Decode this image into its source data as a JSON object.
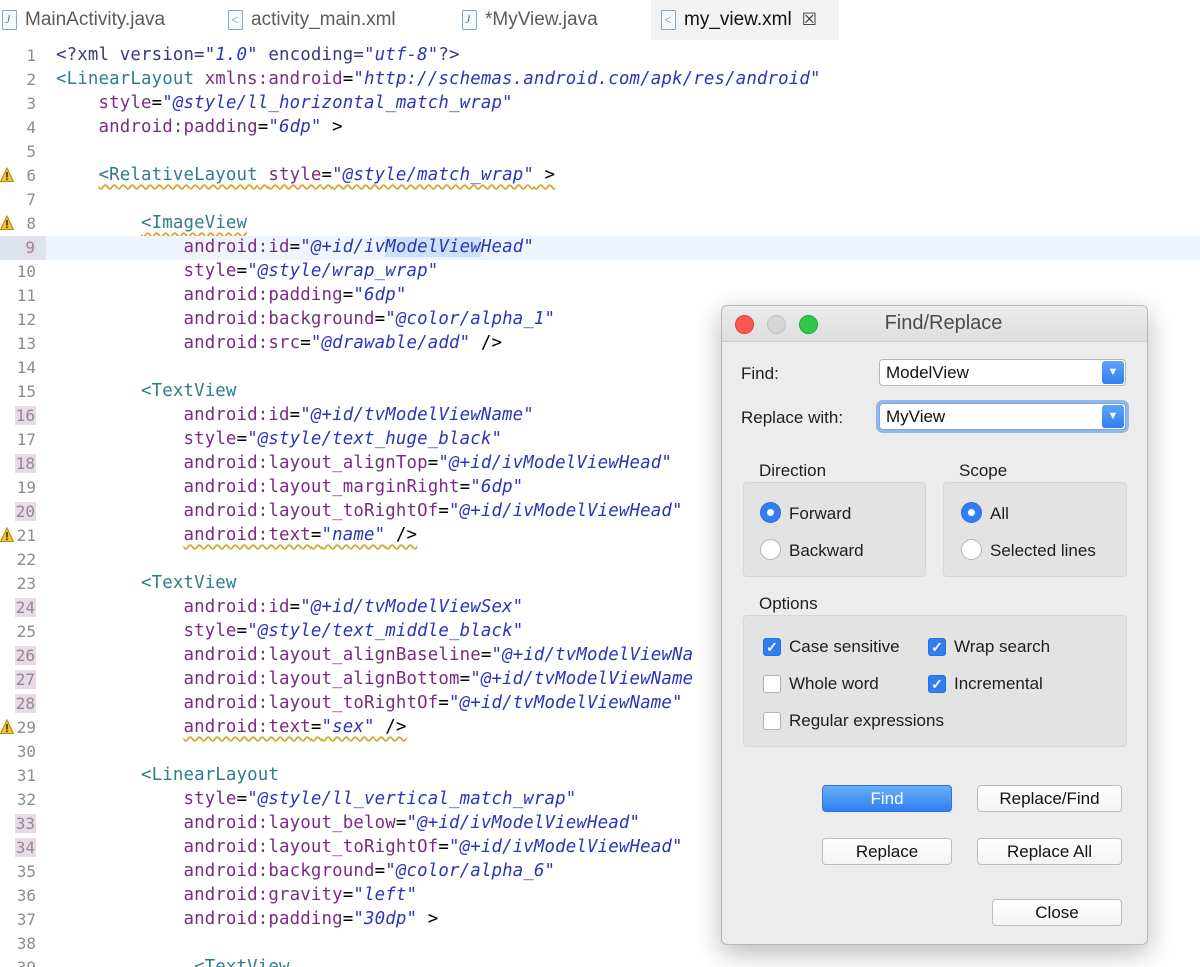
{
  "tabs": [
    {
      "label": "MainActivity.java",
      "icon": "java-file-icon",
      "active": false
    },
    {
      "label": "activity_main.xml",
      "icon": "xml-file-icon",
      "active": false
    },
    {
      "label": "*MyView.java",
      "icon": "java-file-icon",
      "active": false
    },
    {
      "label": "my_view.xml",
      "icon": "xml-file-icon",
      "active": true,
      "close": "☒"
    }
  ],
  "editor": {
    "current_line": 9,
    "lines": [
      {
        "n": "1",
        "text": "<?xml version=\"1.0\" encoding=\"utf-8\"?>"
      },
      {
        "n": "2",
        "text": "<LinearLayout xmlns:android=\"http://schemas.android.com/apk/res/android\""
      },
      {
        "n": "3",
        "text": "    style=\"@style/ll_horizontal_match_wrap\""
      },
      {
        "n": "4",
        "text": "    android:padding=\"6dp\" >"
      },
      {
        "n": "5",
        "text": ""
      },
      {
        "n": "6",
        "text": "    <RelativeLayout style=\"@style/match_wrap\" >",
        "warn": true
      },
      {
        "n": "7",
        "text": ""
      },
      {
        "n": "8",
        "text": "        <ImageView",
        "warn": true
      },
      {
        "n": "9",
        "text": "            android:id=\"@+id/ivModelViewHead\"",
        "marked": true
      },
      {
        "n": "10",
        "text": "            style=\"@style/wrap_wrap\""
      },
      {
        "n": "11",
        "text": "            android:padding=\"6dp\""
      },
      {
        "n": "12",
        "text": "            android:background=\"@color/alpha_1\""
      },
      {
        "n": "13",
        "text": "            android:src=\"@drawable/add\" />"
      },
      {
        "n": "14",
        "text": ""
      },
      {
        "n": "15",
        "text": "        <TextView"
      },
      {
        "n": "16",
        "text": "            android:id=\"@+id/tvModelViewName\"",
        "marked": true
      },
      {
        "n": "17",
        "text": "            style=\"@style/text_huge_black\""
      },
      {
        "n": "18",
        "text": "            android:layout_alignTop=\"@+id/ivModelViewHead\"",
        "marked": true
      },
      {
        "n": "19",
        "text": "            android:layout_marginRight=\"6dp\""
      },
      {
        "n": "20",
        "text": "            android:layout_toRightOf=\"@+id/ivModelViewHead\"",
        "marked": true
      },
      {
        "n": "21",
        "text": "            android:text=\"name\" />",
        "warn": true
      },
      {
        "n": "22",
        "text": ""
      },
      {
        "n": "23",
        "text": "        <TextView"
      },
      {
        "n": "24",
        "text": "            android:id=\"@+id/tvModelViewSex\"",
        "marked": true
      },
      {
        "n": "25",
        "text": "            style=\"@style/text_middle_black\""
      },
      {
        "n": "26",
        "text": "            android:layout_alignBaseline=\"@+id/tvModelViewNa",
        "marked": true
      },
      {
        "n": "27",
        "text": "            android:layout_alignBottom=\"@+id/tvModelViewName",
        "marked": true
      },
      {
        "n": "28",
        "text": "            android:layout_toRightOf=\"@+id/tvModelViewName\"",
        "marked": true
      },
      {
        "n": "29",
        "text": "            android:text=\"sex\" />",
        "warn": true
      },
      {
        "n": "30",
        "text": ""
      },
      {
        "n": "31",
        "text": "        <LinearLayout"
      },
      {
        "n": "32",
        "text": "            style=\"@style/ll_vertical_match_wrap\""
      },
      {
        "n": "33",
        "text": "            android:layout_below=\"@+id/ivModelViewHead\"",
        "marked": true
      },
      {
        "n": "34",
        "text": "            android:layout_toRightOf=\"@+id/ivModelViewHead\"",
        "marked": true
      },
      {
        "n": "35",
        "text": "            android:background=\"@color/alpha_6\""
      },
      {
        "n": "36",
        "text": "            android:gravity=\"left\""
      },
      {
        "n": "37",
        "text": "            android:padding=\"30dp\" >"
      },
      {
        "n": "38",
        "text": ""
      },
      {
        "n": "39",
        "text": "             <TextView"
      }
    ]
  },
  "dialog": {
    "title": "Find/Replace",
    "find_label": "Find:",
    "find_value": "ModelView",
    "replace_label": "Replace with:",
    "replace_value": "MyView",
    "direction": {
      "title": "Direction",
      "options": [
        {
          "label": "Forward",
          "selected": true
        },
        {
          "label": "Backward",
          "selected": false
        }
      ]
    },
    "scope": {
      "title": "Scope",
      "options": [
        {
          "label": "All",
          "selected": true
        },
        {
          "label": "Selected lines",
          "selected": false
        }
      ]
    },
    "options": {
      "title": "Options",
      "items": [
        {
          "label": "Case sensitive",
          "checked": true
        },
        {
          "label": "Wrap search",
          "checked": true
        },
        {
          "label": "Whole word",
          "checked": false
        },
        {
          "label": "Incremental",
          "checked": true
        },
        {
          "label": "Regular expressions",
          "checked": false
        }
      ]
    },
    "buttons": {
      "find": "Find",
      "replace_find": "Replace/Find",
      "replace": "Replace",
      "replace_all": "Replace All",
      "close": "Close"
    }
  },
  "colors": {
    "tag": "#2e7d8c",
    "attribute": "#7b2c82",
    "value": "#2a36b8",
    "accent_blue": "#2f7ff2",
    "warning": "#d4a42a"
  }
}
